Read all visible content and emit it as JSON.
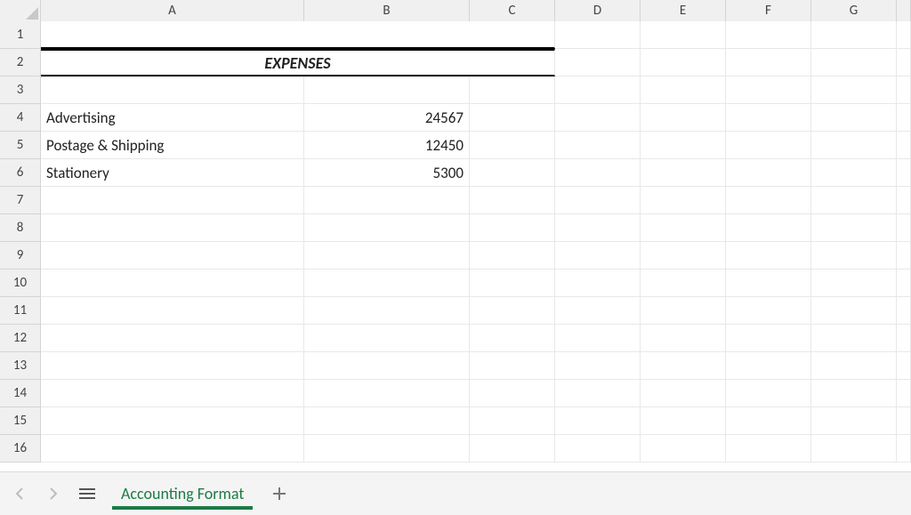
{
  "columns": [
    "A",
    "B",
    "C",
    "D",
    "E",
    "F",
    "G"
  ],
  "rowCount": 16,
  "title_row": 2,
  "title_text": "EXPENSES",
  "data_rows": [
    {
      "r": 4,
      "a": "Advertising",
      "b": "24567"
    },
    {
      "r": 5,
      "a": "Postage & Shipping",
      "b": "12450"
    },
    {
      "r": 6,
      "a": "Stationery",
      "b": "5300"
    }
  ],
  "tabs": {
    "active": "Accounting Format"
  },
  "chart_data": {
    "type": "table",
    "title": "EXPENSES",
    "categories": [
      "Advertising",
      "Postage & Shipping",
      "Stationery"
    ],
    "values": [
      24567,
      12450,
      5300
    ]
  }
}
